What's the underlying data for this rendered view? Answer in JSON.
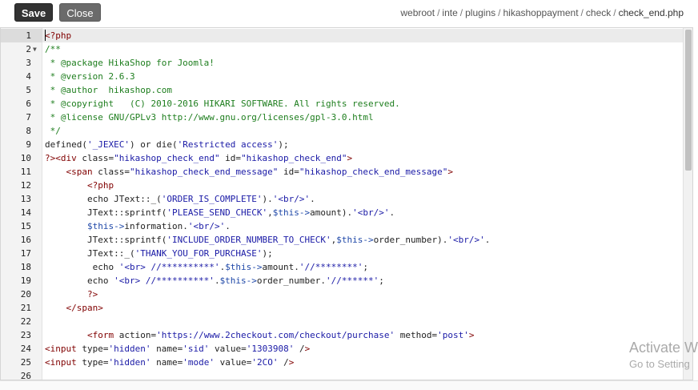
{
  "toolbar": {
    "save_label": "Save",
    "close_label": "Close"
  },
  "breadcrumb": {
    "items": [
      "webroot",
      "inte",
      "plugins",
      "hikashoppayment",
      "check"
    ],
    "current": "check_end.php",
    "separator": "/"
  },
  "editor": {
    "active_line": 1,
    "lines": [
      {
        "n": "1",
        "fold": "",
        "text": "<?php"
      },
      {
        "n": "2",
        "fold": "▼",
        "text": "/**"
      },
      {
        "n": "3",
        "fold": "",
        "text": " * @package HikaShop for Joomla!"
      },
      {
        "n": "4",
        "fold": "",
        "text": " * @version 2.6.3"
      },
      {
        "n": "5",
        "fold": "",
        "text": " * @author  hikashop.com"
      },
      {
        "n": "6",
        "fold": "",
        "text": " * @copyright   (C) 2010-2016 HIKARI SOFTWARE. All rights reserved."
      },
      {
        "n": "7",
        "fold": "",
        "text": " * @license GNU/GPLv3 http://www.gnu.org/licenses/gpl-3.0.html"
      },
      {
        "n": "8",
        "fold": "",
        "text": " */"
      },
      {
        "n": "9",
        "fold": "",
        "text": "defined('_JEXEC') or die('Restricted access');"
      },
      {
        "n": "10",
        "fold": "",
        "text": "?><div class=\"hikashop_check_end\" id=\"hikashop_check_end\">"
      },
      {
        "n": "11",
        "fold": "",
        "text": "    <span class=\"hikashop_check_end_message\" id=\"hikashop_check_end_message\">"
      },
      {
        "n": "12",
        "fold": "",
        "text": "        <?php"
      },
      {
        "n": "13",
        "fold": "",
        "text": "        echo JText::_('ORDER_IS_COMPLETE').'<br/>'."
      },
      {
        "n": "14",
        "fold": "",
        "text": "        JText::sprintf('PLEASE_SEND_CHECK',$this->amount).'<br/>'."
      },
      {
        "n": "15",
        "fold": "",
        "text": "        $this->information.'<br/>'."
      },
      {
        "n": "16",
        "fold": "",
        "text": "        JText::sprintf('INCLUDE_ORDER_NUMBER_TO_CHECK',$this->order_number).'<br/>'."
      },
      {
        "n": "17",
        "fold": "",
        "text": "        JText::_('THANK_YOU_FOR_PURCHASE');"
      },
      {
        "n": "18",
        "fold": "",
        "text": "         echo '<br> //**********'.$this->amount.'//********';"
      },
      {
        "n": "19",
        "fold": "",
        "text": "        echo '<br> //**********'.$this->order_number.'//******';"
      },
      {
        "n": "20",
        "fold": "",
        "text": "        ?>"
      },
      {
        "n": "21",
        "fold": "",
        "text": "    </span>"
      },
      {
        "n": "22",
        "fold": "",
        "text": ""
      },
      {
        "n": "23",
        "fold": "",
        "text": "        <form action='https://www.2checkout.com/checkout/purchase' method='post'>"
      },
      {
        "n": "24",
        "fold": "",
        "text": "<input type='hidden' name='sid' value='1303908' />"
      },
      {
        "n": "25",
        "fold": "",
        "text": "<input type='hidden' name='mode' value='2CO' />"
      },
      {
        "n": "26",
        "fold": "",
        "text": ""
      }
    ]
  },
  "watermark": {
    "line1": "Activate W",
    "line2": "Go to Setting"
  },
  "colors": {
    "save_bg": "#333333",
    "close_bg": "#6b6b6b",
    "comment": "#1e7e1e",
    "string": "#1a1aa6",
    "tag": "#800000",
    "variable": "#1f48a8"
  }
}
